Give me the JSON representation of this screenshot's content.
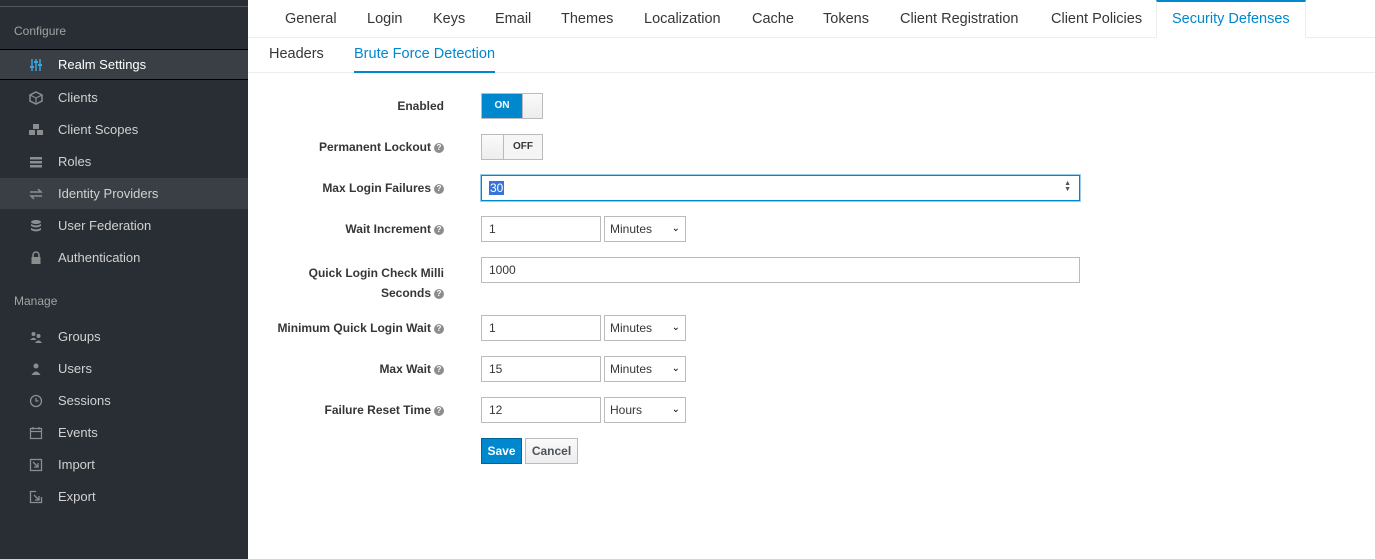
{
  "sidebar": {
    "configure_label": "Configure",
    "manage_label": "Manage",
    "configure_items": [
      {
        "label": "Realm Settings",
        "icon": "sliders-icon"
      },
      {
        "label": "Clients",
        "icon": "cube-icon"
      },
      {
        "label": "Client Scopes",
        "icon": "cubes-icon"
      },
      {
        "label": "Roles",
        "icon": "list-icon"
      },
      {
        "label": "Identity Providers",
        "icon": "exchange-icon"
      },
      {
        "label": "User Federation",
        "icon": "database-icon"
      },
      {
        "label": "Authentication",
        "icon": "lock-icon"
      }
    ],
    "manage_items": [
      {
        "label": "Groups",
        "icon": "users-icon"
      },
      {
        "label": "Users",
        "icon": "user-icon"
      },
      {
        "label": "Sessions",
        "icon": "clock-icon"
      },
      {
        "label": "Events",
        "icon": "calendar-icon"
      },
      {
        "label": "Import",
        "icon": "import-icon"
      },
      {
        "label": "Export",
        "icon": "export-icon"
      }
    ]
  },
  "tabs": [
    "General",
    "Login",
    "Keys",
    "Email",
    "Themes",
    "Localization",
    "Cache",
    "Tokens",
    "Client Registration",
    "Client Policies",
    "Security Defenses"
  ],
  "active_tab": "Security Defenses",
  "subtabs": [
    "Headers",
    "Brute Force Detection"
  ],
  "active_subtab": "Brute Force Detection",
  "form": {
    "enabled_label": "Enabled",
    "enabled_value": "ON",
    "permanent_lockout_label": "Permanent Lockout",
    "permanent_lockout_value": "OFF",
    "max_login_failures_label": "Max Login Failures",
    "max_login_failures_value": "30",
    "wait_increment_label": "Wait Increment",
    "wait_increment_value": "1",
    "wait_increment_unit": "Minutes",
    "quick_login_label_line1": "Quick Login Check Milli",
    "quick_login_label_line2": "Seconds",
    "quick_login_value": "1000",
    "min_quick_login_wait_label": "Minimum Quick Login Wait",
    "min_quick_login_wait_value": "1",
    "min_quick_login_wait_unit": "Minutes",
    "max_wait_label": "Max Wait",
    "max_wait_value": "15",
    "max_wait_unit": "Minutes",
    "failure_reset_time_label": "Failure Reset Time",
    "failure_reset_time_value": "12",
    "failure_reset_time_unit": "Hours",
    "save_label": "Save",
    "cancel_label": "Cancel"
  },
  "colors": {
    "sidebar_bg": "#292e34",
    "accent": "#0088ce"
  }
}
